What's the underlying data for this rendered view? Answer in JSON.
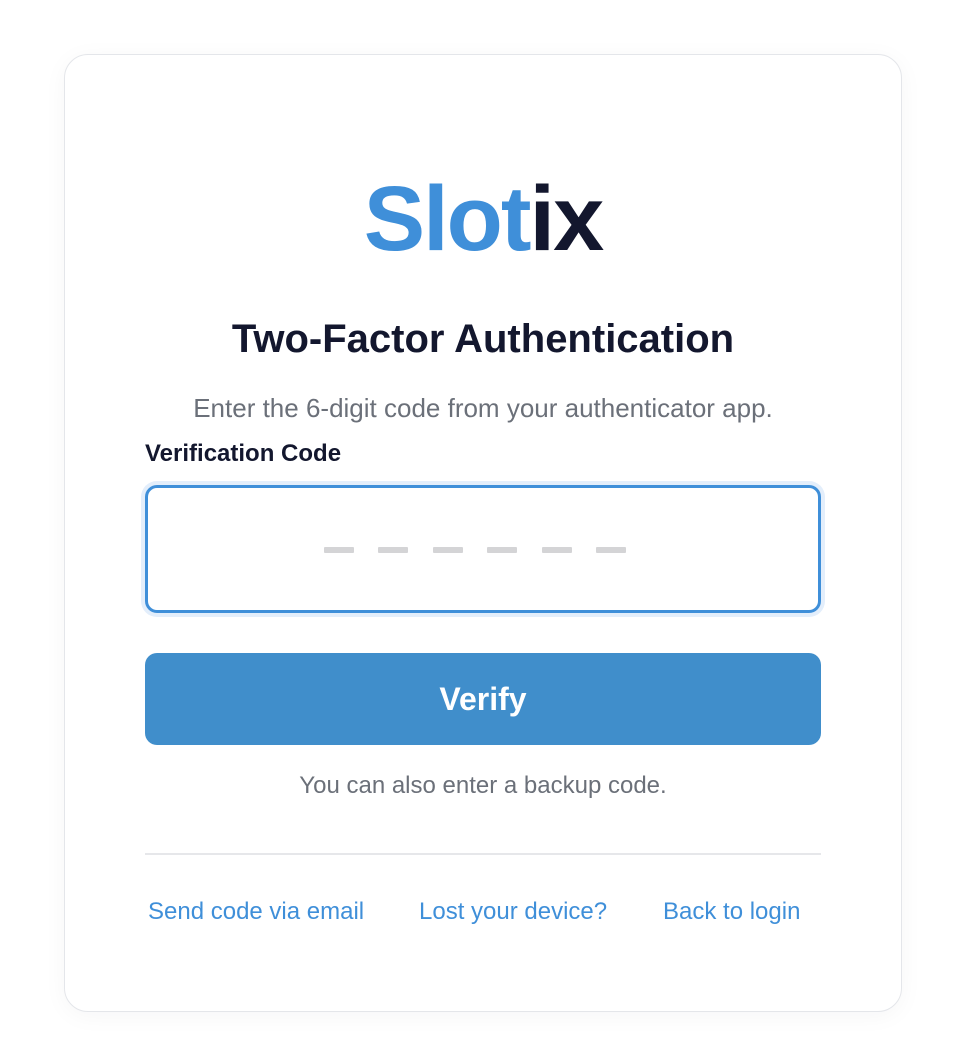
{
  "logo": {
    "part_accent": "Slot",
    "part_dark": "ix",
    "accent_color": "#3f8fd9",
    "dark_color": "#13172e"
  },
  "title": "Two-Factor Authentication",
  "subtitle": "Enter the 6-digit code from your authenticator app.",
  "form": {
    "label": "Verification Code",
    "code_value": "",
    "code_placeholder": "— — — — — —",
    "digit_count": 6,
    "submit_label": "Verify"
  },
  "backup_note": "You can also enter a backup code.",
  "links": {
    "send_email": "Send code via email",
    "lost_device": "Lost your device?",
    "back_to_login": "Back to login"
  },
  "colors": {
    "primary": "#408ecb",
    "text_dark": "#13172e",
    "text_muted": "#6b7079",
    "link": "#3f8fd9"
  }
}
